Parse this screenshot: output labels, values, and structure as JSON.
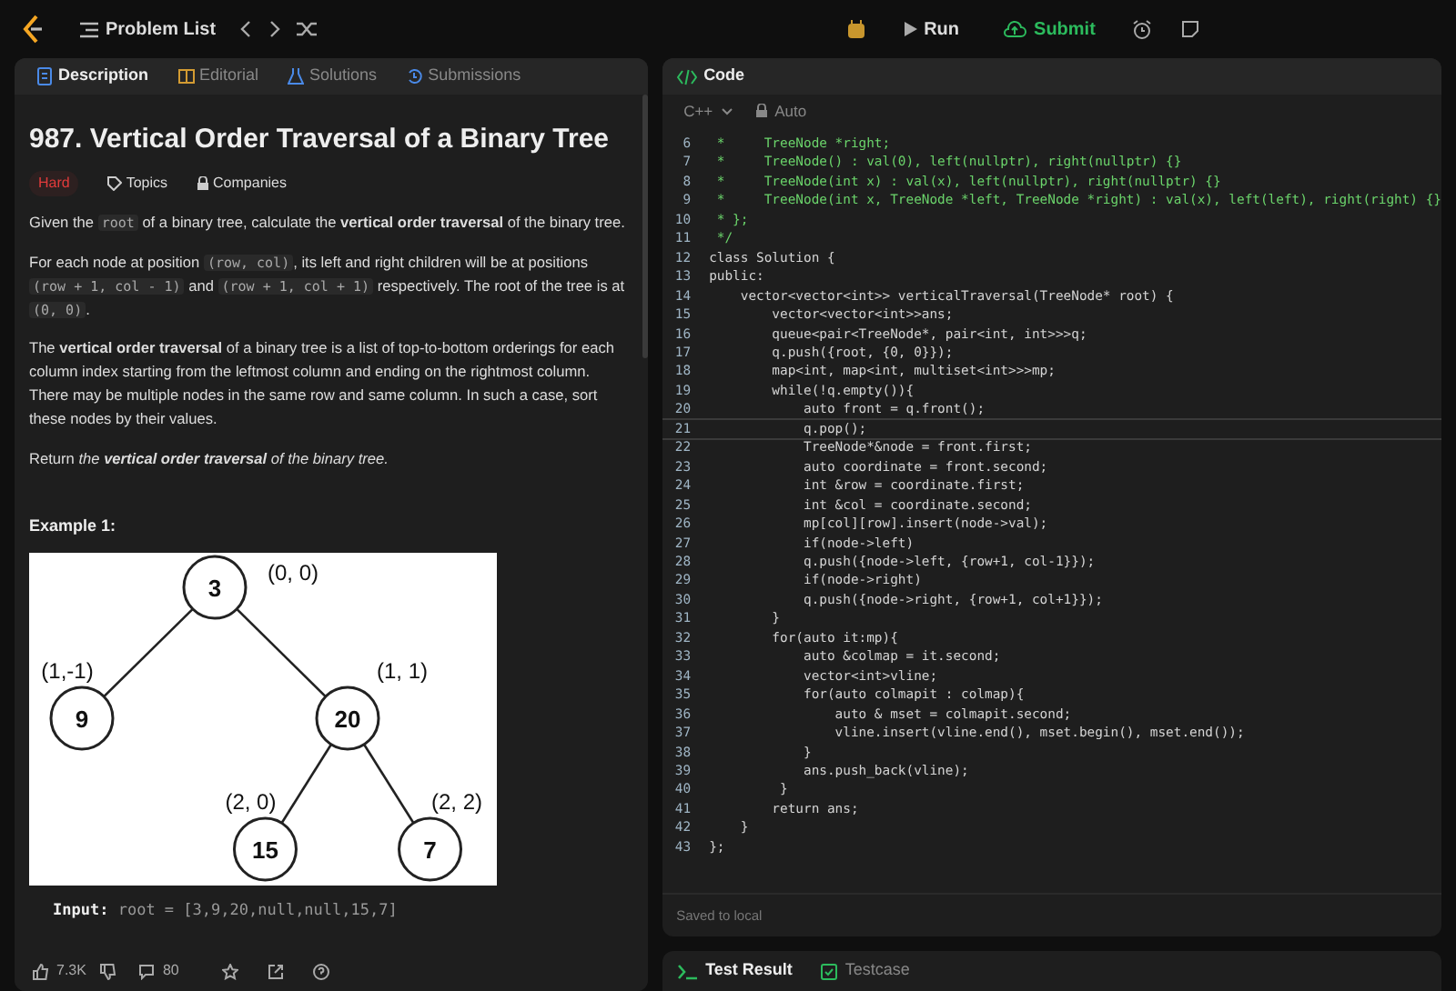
{
  "topbar": {
    "problem_list": "Problem List",
    "run": "Run",
    "submit": "Submit"
  },
  "left_tabs": [
    {
      "label": "Description",
      "selected": true
    },
    {
      "label": "Editorial",
      "selected": false
    },
    {
      "label": "Solutions",
      "selected": false
    },
    {
      "label": "Submissions",
      "selected": false
    }
  ],
  "problem": {
    "title": "987. Vertical Order Traversal of a Binary Tree",
    "difficulty": "Hard",
    "topics": "Topics",
    "companies": "Companies",
    "paragraphs": [
      [
        {
          "kind": "text",
          "text": "Given the "
        },
        {
          "kind": "code",
          "text": "root"
        },
        {
          "kind": "text",
          "text": " of a binary tree, calculate the **vertical order traversal** of the binary tree."
        }
      ],
      [
        {
          "kind": "text",
          "text": "For each node at position "
        },
        {
          "kind": "code",
          "text": "(row, col)"
        },
        {
          "kind": "text",
          "text": ", its left and right children will be at positions "
        },
        {
          "kind": "code",
          "text": "(row + 1, col - 1)"
        },
        {
          "kind": "text",
          "text": " and "
        },
        {
          "kind": "code",
          "text": "(row + 1, col + 1)"
        },
        {
          "kind": "text",
          "text": " respectively. The root of the tree is at "
        },
        {
          "kind": "code",
          "text": "(0, 0)"
        },
        {
          "kind": "text",
          "text": "."
        }
      ],
      [
        {
          "kind": "text",
          "text": "The **vertical order traversal** of a binary tree is a list of top-to-bottom orderings for each column index starting from the leftmost column and ending on the rightmost column. There may be multiple nodes in the same row and same column. In such a case, sort these nodes by their values."
        }
      ],
      [
        {
          "kind": "text",
          "text": "Return "
        },
        {
          "kind": "italic",
          "text": "the **vertical order traversal** of the binary tree."
        }
      ]
    ],
    "example_heading": "Example 1:",
    "tree": {
      "value": "3",
      "label": "(0, 0)",
      "children": [
        {
          "value": "9",
          "label": "(1,-1)"
        },
        {
          "value": "20",
          "label": "(1, 1)",
          "children": [
            {
              "value": "15",
              "label": "(2, 0)"
            },
            {
              "value": "7",
              "label": "(2, 2)"
            }
          ]
        }
      ]
    },
    "input_label": "Input:",
    "input_value": "root = [3,9,20,null,null,15,7]"
  },
  "footer": {
    "likes": "7.3K",
    "comments": "80"
  },
  "code_panel": {
    "title": "Code",
    "language": "C++",
    "mode": "Auto",
    "saved": "Saved to local",
    "lines": [
      {
        "n": "6",
        "kind": "comment",
        "text": " *     TreeNode *right;",
        "current": false
      },
      {
        "n": "7",
        "kind": "comment",
        "text": " *     TreeNode() : val(0), left(nullptr), right(nullptr) {}",
        "current": false
      },
      {
        "n": "8",
        "kind": "comment",
        "text": " *     TreeNode(int x) : val(x), left(nullptr), right(nullptr) {}",
        "current": false
      },
      {
        "n": "9",
        "kind": "comment",
        "text": " *     TreeNode(int x, TreeNode *left, TreeNode *right) : val(x), left(left), right(right) {}",
        "current": false
      },
      {
        "n": "10",
        "kind": "comment",
        "text": " * };",
        "current": false
      },
      {
        "n": "11",
        "kind": "comment",
        "text": " */",
        "current": false
      },
      {
        "n": "12",
        "kind": "code",
        "text": "class Solution {",
        "current": false
      },
      {
        "n": "13",
        "kind": "code",
        "text": "public:",
        "current": false
      },
      {
        "n": "14",
        "kind": "code",
        "text": "    vector<vector<int>> verticalTraversal(TreeNode* root) {",
        "current": false
      },
      {
        "n": "15",
        "kind": "code",
        "text": "        vector<vector<int>>ans;",
        "current": false
      },
      {
        "n": "16",
        "kind": "code",
        "text": "        queue<pair<TreeNode*, pair<int, int>>>q;",
        "current": false
      },
      {
        "n": "17",
        "kind": "code",
        "text": "        q.push({root, {0, 0}});",
        "current": false
      },
      {
        "n": "18",
        "kind": "code",
        "text": "        map<int, map<int, multiset<int>>>mp;",
        "current": false
      },
      {
        "n": "19",
        "kind": "code",
        "text": "        while(!q.empty()){",
        "current": false
      },
      {
        "n": "20",
        "kind": "code",
        "text": "            auto front = q.front();",
        "current": false
      },
      {
        "n": "21",
        "kind": "code",
        "text": "            q.pop();",
        "current": true
      },
      {
        "n": "22",
        "kind": "code",
        "text": "            TreeNode*&node = front.first;",
        "current": false
      },
      {
        "n": "23",
        "kind": "code",
        "text": "            auto coordinate = front.second;",
        "current": false
      },
      {
        "n": "24",
        "kind": "code",
        "text": "            int &row = coordinate.first;",
        "current": false
      },
      {
        "n": "25",
        "kind": "code",
        "text": "            int &col = coordinate.second;",
        "current": false
      },
      {
        "n": "26",
        "kind": "code",
        "text": "            mp[col][row].insert(node->val);",
        "current": false
      },
      {
        "n": "27",
        "kind": "code",
        "text": "            if(node->left)",
        "current": false
      },
      {
        "n": "28",
        "kind": "code",
        "text": "            q.push({node->left, {row+1, col-1}});",
        "current": false
      },
      {
        "n": "29",
        "kind": "code",
        "text": "            if(node->right)",
        "current": false
      },
      {
        "n": "30",
        "kind": "code",
        "text": "            q.push({node->right, {row+1, col+1}});",
        "current": false
      },
      {
        "n": "31",
        "kind": "code",
        "text": "        }",
        "current": false
      },
      {
        "n": "32",
        "kind": "code",
        "text": "        for(auto it:mp){",
        "current": false
      },
      {
        "n": "33",
        "kind": "code",
        "text": "            auto &colmap = it.second;",
        "current": false
      },
      {
        "n": "34",
        "kind": "code",
        "text": "            vector<int>vline;",
        "current": false
      },
      {
        "n": "35",
        "kind": "code",
        "text": "            for(auto colmapit : colmap){",
        "current": false
      },
      {
        "n": "36",
        "kind": "code",
        "text": "                auto & mset = colmapit.second;",
        "current": false
      },
      {
        "n": "37",
        "kind": "code",
        "text": "                vline.insert(vline.end(), mset.begin(), mset.end());",
        "current": false
      },
      {
        "n": "38",
        "kind": "code",
        "text": "            }",
        "current": false
      },
      {
        "n": "39",
        "kind": "code",
        "text": "            ans.push_back(vline);",
        "current": false
      },
      {
        "n": "40",
        "kind": "code",
        "text": "         }",
        "current": false
      },
      {
        "n": "41",
        "kind": "code",
        "text": "        return ans;",
        "current": false
      },
      {
        "n": "42",
        "kind": "code",
        "text": "    }",
        "current": false
      },
      {
        "n": "43",
        "kind": "code",
        "text": "};",
        "current": false
      }
    ]
  },
  "bottom_tabs": [
    {
      "label": "Test Result",
      "selected": true
    },
    {
      "label": "Testcase",
      "selected": false
    }
  ]
}
